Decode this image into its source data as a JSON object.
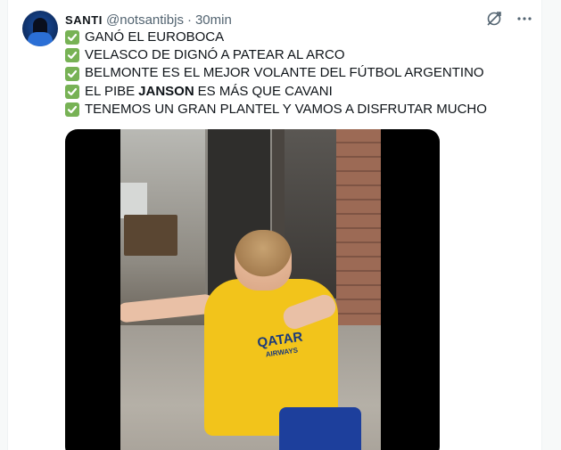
{
  "tweet": {
    "display_name": "SANTI",
    "handle": "@notsantibjs",
    "separator": "·",
    "time": "30min",
    "lines": [
      {
        "emoji": "check-mark-icon",
        "text": "GANÓ EL EUROBOCA"
      },
      {
        "emoji": "check-mark-icon",
        "text": "VELASCO DE DIGNÓ A PATEAR AL ARCO"
      },
      {
        "emoji": "check-mark-icon",
        "text": "BELMONTE ES EL MEJOR VOLANTE DEL FÚTBOL ARGENTINO"
      },
      {
        "emoji": "check-mark-icon",
        "text_before": "EL PIBE",
        "text_bold": "JANSON",
        "text_after": "ES MÁS QUE CAVANI"
      },
      {
        "emoji": "check-mark-icon",
        "text": "TENEMOS UN GRAN PLANTEL Y VAMOS A DISFRUTAR MUCHO"
      }
    ],
    "media": {
      "shirt_text_line1": "QATAR",
      "shirt_text_line2": "AIRWAYS"
    }
  },
  "colors": {
    "check_green": "#77b255",
    "secondary_text": "#536471",
    "background": "#f7f9f9",
    "card": "#ffffff"
  }
}
